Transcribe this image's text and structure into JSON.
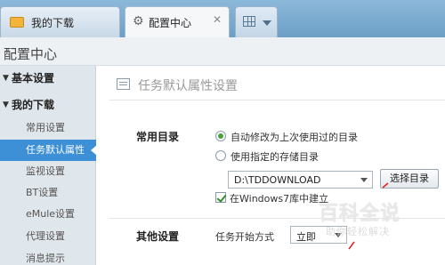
{
  "tabs": [
    {
      "label": "我的下载",
      "icon": "folder-icon"
    },
    {
      "label": "配置中心",
      "icon": "gear-icon",
      "close_glyph": "✕"
    },
    {
      "icon": "grid-icon"
    }
  ],
  "header": {
    "title": "配置中心"
  },
  "sidebar": {
    "groups": [
      {
        "label": "基本设置",
        "expanded": true
      },
      {
        "label": "我的下载",
        "expanded": true
      }
    ],
    "items": [
      {
        "label": "常用设置",
        "active": false
      },
      {
        "label": "任务默认属性",
        "active": true
      },
      {
        "label": "监视设置",
        "active": false
      },
      {
        "label": "BT设置",
        "active": false
      },
      {
        "label": "eMule设置",
        "active": false
      },
      {
        "label": "代理设置",
        "active": false
      },
      {
        "label": "消息提示",
        "active": false
      }
    ]
  },
  "main": {
    "section_title": "任务默认属性设置",
    "common_dir": {
      "label": "常用目录",
      "radio_auto": "自动修改为上次使用过的目录",
      "radio_custom": "使用指定的存储目录",
      "selected": "auto",
      "path_value": "D:\\TDDOWNLOAD",
      "choose_button": "选择目录",
      "win7_checkbox": "在Windows7库中建立",
      "win7_checked": true
    },
    "other": {
      "label": "其他设置",
      "start_mode_label": "任务开始方式",
      "start_mode_value": "立即"
    }
  },
  "watermark": {
    "title": "百科全说",
    "subtitle": "助你轻松解决"
  },
  "colors": {
    "tabbar": "#7aaad0",
    "active_item": "#3d8fd6",
    "radio_dot": "#48a33a",
    "annotation": "#e02020"
  }
}
